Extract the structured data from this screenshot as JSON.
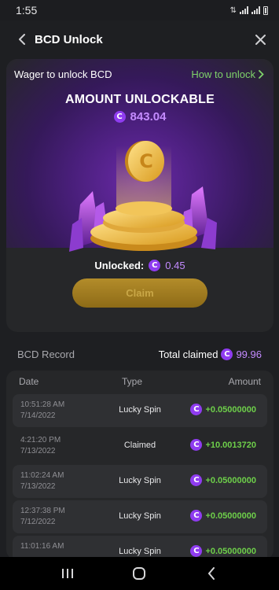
{
  "status_bar": {
    "time": "1:55"
  },
  "header": {
    "title": "BCD Unlock"
  },
  "card": {
    "wager_label": "Wager to unlock BCD",
    "how_link": "How to unlock",
    "amount_title": "AMOUNT UNLOCKABLE",
    "amount_value": "843.04",
    "unlocked_label": "Unlocked:",
    "unlocked_value": "0.45",
    "claim_label": "Claim"
  },
  "record": {
    "title": "BCD Record",
    "total_label": "Total claimed",
    "total_value": "99.96"
  },
  "table": {
    "columns": {
      "date": "Date",
      "type": "Type",
      "amount": "Amount"
    },
    "rows": [
      {
        "time": "10:51:28 AM",
        "date": "7/14/2022",
        "type": "Lucky Spin",
        "amount": "+0.05000000"
      },
      {
        "time": "4:21:20 PM",
        "date": "7/13/2022",
        "type": "Claimed",
        "amount": "+10.0013720"
      },
      {
        "time": "11:02:24 AM",
        "date": "7/13/2022",
        "type": "Lucky Spin",
        "amount": "+0.05000000"
      },
      {
        "time": "12:37:38 PM",
        "date": "7/12/2022",
        "type": "Lucky Spin",
        "amount": "+0.05000000"
      },
      {
        "time": "11:01:16 AM",
        "date": "",
        "type": "Lucky Spin",
        "amount": "+0.05000000"
      }
    ]
  },
  "icons": {
    "coin": "bcd-coin-icon",
    "back": "chevron-left-icon",
    "close": "close-icon"
  },
  "colors": {
    "accent_purple": "#c48bff",
    "link_green": "#7fd36a",
    "amount_green": "#6ed04a",
    "claim_gold": "#b38c2a"
  }
}
